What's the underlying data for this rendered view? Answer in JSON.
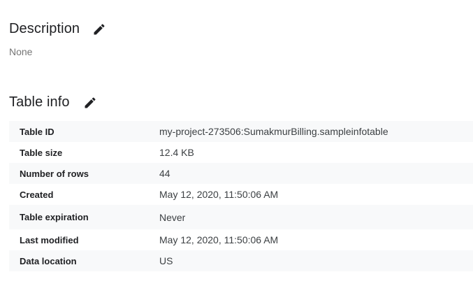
{
  "description": {
    "title": "Description",
    "value": "None",
    "edit_icon": "pencil-icon"
  },
  "table_info": {
    "title": "Table info",
    "edit_icon": "pencil-icon",
    "rows": [
      {
        "label": "Table ID",
        "value": "my-project-273506:SumakmurBilling.sampleinfotable"
      },
      {
        "label": "Table size",
        "value": "12.4 KB"
      },
      {
        "label": "Number of rows",
        "value": "44"
      },
      {
        "label": "Created",
        "value": "May 12, 2020, 11:50:06 AM"
      },
      {
        "label": "Table expiration",
        "value": "Never"
      },
      {
        "label": "Last modified",
        "value": "May 12, 2020, 11:50:06 AM"
      },
      {
        "label": "Data location",
        "value": "US"
      }
    ]
  },
  "colors": {
    "row_shade": "#f8f9fa",
    "text_primary": "#202124",
    "text_secondary": "#757575"
  }
}
